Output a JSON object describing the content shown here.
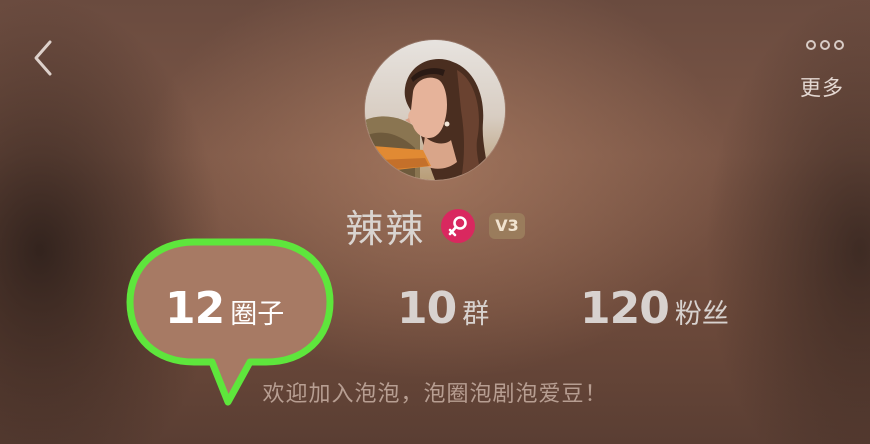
{
  "header": {
    "back_icon": "chevron-left-icon",
    "more_icon": "more-dots-icon",
    "more_label": "更多"
  },
  "profile": {
    "avatar": "user-avatar",
    "name": "辣辣",
    "gender_icon": "female-icon",
    "gender_color": "#d9285f",
    "level": "V3",
    "level_color": "#9a7c5c"
  },
  "stats": [
    {
      "count": "12",
      "label": "圈子"
    },
    {
      "count": "10",
      "label": "群"
    },
    {
      "count": "120",
      "label": "粉丝"
    }
  ],
  "highlight": {
    "color": "#5ee63c",
    "fill": "#a77a64"
  },
  "bio": "欢迎加入泡泡，泡圈泡剧泡爱豆！"
}
